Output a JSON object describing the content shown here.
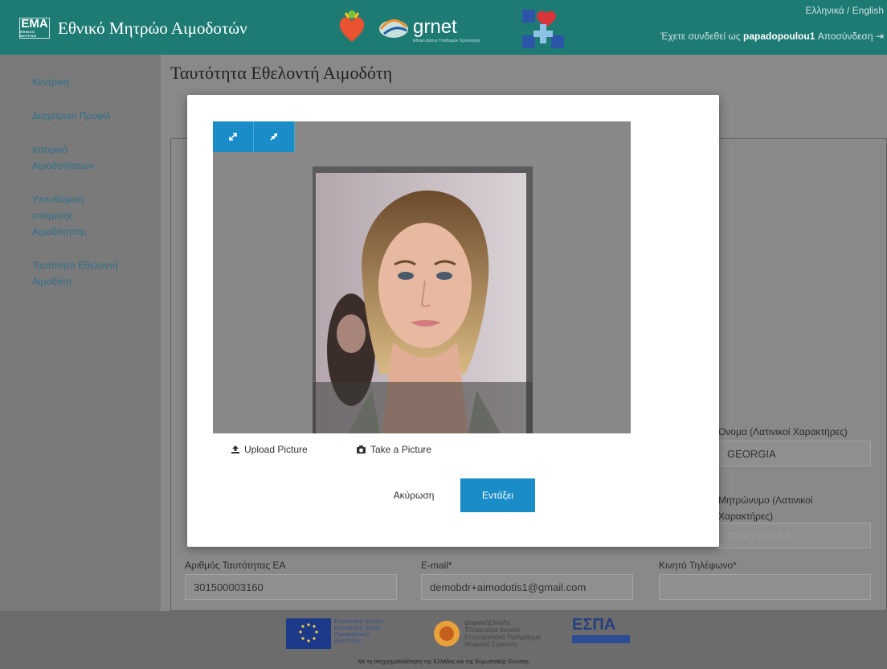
{
  "header": {
    "logo_text": "EMA",
    "title": "Εθνικό Μητρώο Αιμοδοτών",
    "grnet": "grnet",
    "grnet_sub": "Εθνικό Δίκτυο Υποδομών Τεχνολογίας",
    "lang": "Ελληνικά / English",
    "logged_prefix": "Έχετε συνδεθεί ως ",
    "username": "papadopoulou1",
    "logout": "Αποσύνδεση"
  },
  "sidebar": {
    "items": [
      {
        "label": "Κεντρική"
      },
      {
        "label": "Διαχείριση Προφίλ"
      },
      {
        "label": "Ιστορικό\nΑιμοδοτήσεων"
      },
      {
        "label": "Υπενθύμιση\nεπόμενης\nΑιμοδότησης"
      },
      {
        "label": "Ταυτότητα Εθελοντή\nΑιμοδότη"
      }
    ]
  },
  "page": {
    "title": "Ταυτότητα Εθελοντή Αιμοδότη",
    "fields": {
      "first_name_latin_label": "Όνομα (Λατινικοί Χαρακτήρες)",
      "first_name_latin_value": "GEORGIA",
      "mother_name_latin_label": "Μητρώνυμο (Λατινικοί\nΧαρακτήρες)",
      "mother_name_latin_value": "CHRYSOULA",
      "id_number_label": "Αριθμός Ταυτότητας ΕΑ",
      "id_number_value": "301500003160",
      "email_label": "E-mail*",
      "email_value": "demobdr+aimodotis1@gmail.com",
      "mobile_label": "Κινητό Τηλέφωνο*",
      "mobile_value": ""
    }
  },
  "modal": {
    "upload_label": "Upload Picture",
    "take_label": "Take a Picture",
    "cancel_label": "Ακύρωση",
    "ok_label": "Εντάξει"
  },
  "footer": {
    "eu_text": "Ευρωπαϊκή Ένωση\nΕυρωπαϊκό Ταμείο\nΠεριφερειακής\nΑνάπτυξης",
    "logo2_text": "ψηφιακήΕλλάδα\nΤίποτα είναι δυνατό\nΕπιχειρησιακό Πρόγραμμα\nΨηφιακή Σύγκλιση",
    "espa": "ΕΣΠΑ",
    "note": "Με τη συγχρηματοδότηση της Ελλάδας και της Ευρωπαϊκής Ένωσης"
  },
  "colors": {
    "header_bg": "#1e7b74",
    "primary_button": "#1a8cc7",
    "link": "#2f6f8a"
  }
}
